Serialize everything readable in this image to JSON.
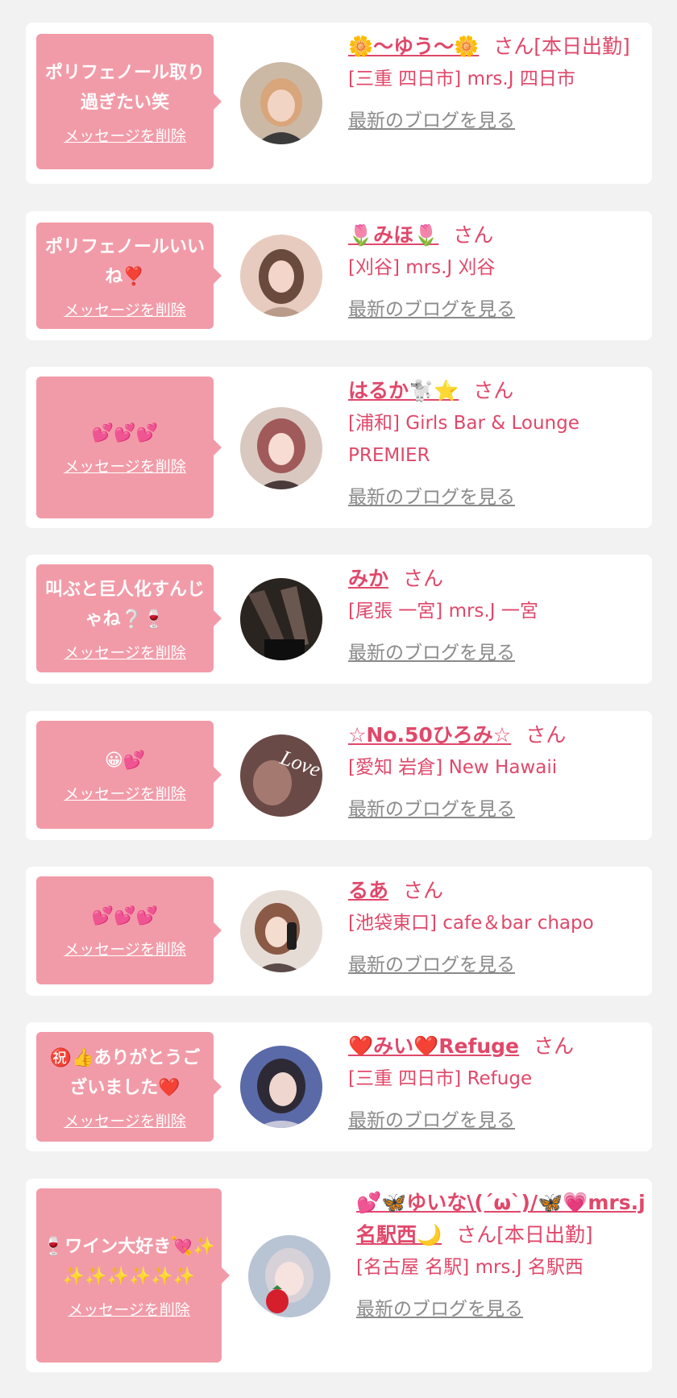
{
  "delete_label": "メッセージを削除",
  "blog_label": "最新のブログを見る",
  "honorific": "さん",
  "cards": [
    {
      "message": "ポリフェノール取り過ぎたい笑",
      "name": "🌼〜ゆう〜🌼",
      "name_suffix": "さん[本日出勤]",
      "shop": "[三重 四日市] mrs.J 四日市"
    },
    {
      "message": "ポリフェノールいいね❣️",
      "name": "🌷みほ🌷",
      "name_suffix": "さん",
      "shop": "[刈谷] mrs.J 刈谷"
    },
    {
      "message": "💕💕💕",
      "name": "はるか🐩⭐",
      "name_suffix": "さん",
      "shop": "[浦和] Girls Bar & Lounge PREMIER"
    },
    {
      "message": "叫ぶと巨人化すんじゃね❔🍷",
      "name": "みか",
      "name_suffix": "さん",
      "shop": "[尾張 一宮] mrs.J 一宮"
    },
    {
      "message": "😀💕",
      "name": "☆No.50ひろみ☆",
      "name_suffix": "さん",
      "shop": "[愛知 岩倉] New Hawaii"
    },
    {
      "message": "💕💕💕",
      "name": "るあ",
      "name_suffix": "さん",
      "shop": "[池袋東口] cafe＆bar chapo"
    },
    {
      "message": "㊗️👍ありがとうございました❤️",
      "name": "❤️みい❤️Refuge",
      "name_suffix": "さん",
      "shop": "[三重 四日市] Refuge"
    },
    {
      "message": "🍷ワイン大好き💘✨✨✨✨✨✨✨",
      "name": "💕🦋ゆいな\\(´ω`)/🦋💗mrs.j名駅西🌙",
      "name_suffix": "さん[本日出勤]",
      "shop": "[名古屋 名駅] mrs.J 名駅西"
    }
  ]
}
